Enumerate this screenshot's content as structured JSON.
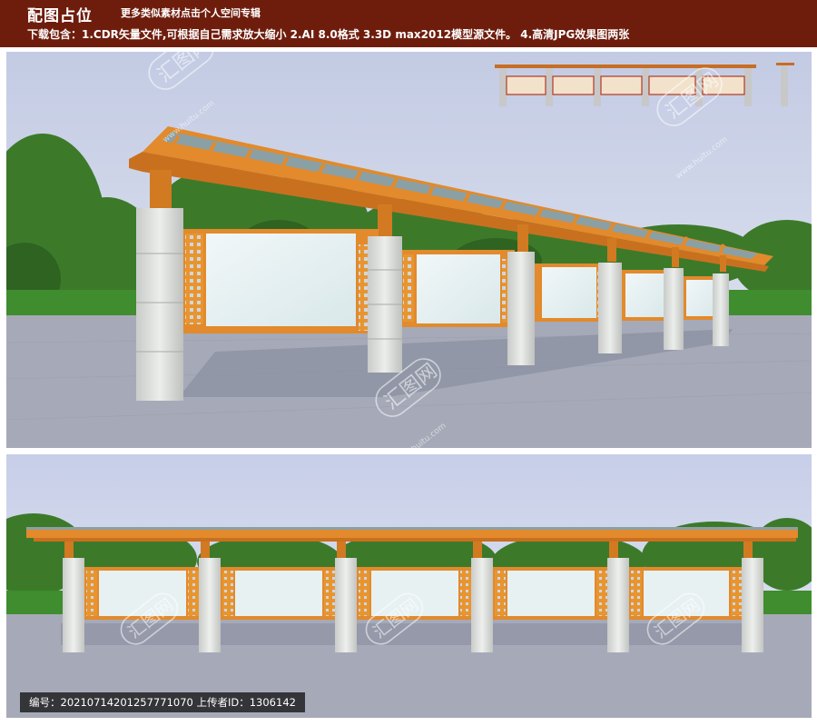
{
  "header": {
    "title": "配图占位",
    "subtitle": "更多类似素材点击个人空间专辑",
    "download_info": "下载包含：1.CDR矢量文件,可根据自己需求放大缩小  2.AI 8.0格式  3.3D max2012模型源文件。  4.高清JPG效果图两张"
  },
  "watermark": {
    "text": "汇图网",
    "url": "www.huitu.com"
  },
  "footer": {
    "info": "编号：20210714201257771070 上传者ID：1306142"
  },
  "colors": {
    "header_bg": "#6e1d0d",
    "wood": "#e28a2c",
    "glass": "#8ba0a4",
    "panel": "#e6f1f2",
    "stone": "#d6d8d6",
    "sky": "#cfd6ea",
    "pavement": "#a6aab8",
    "trees": "#3c7a2a"
  }
}
